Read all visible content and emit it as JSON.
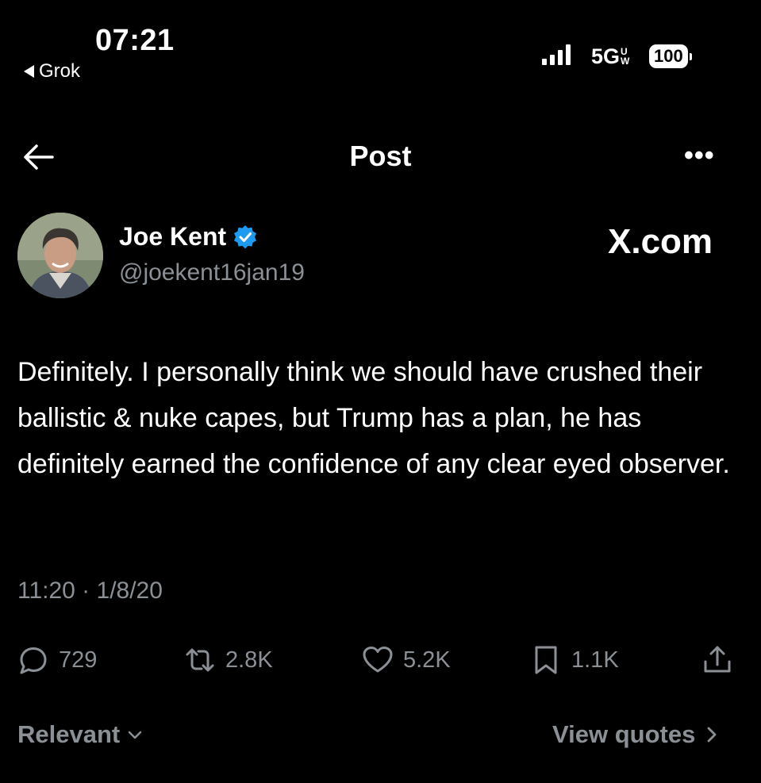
{
  "status_bar": {
    "time": "07:21",
    "back_app": "Grok",
    "network": "5G",
    "network_sup": "U",
    "network_sub": "W",
    "battery": "100"
  },
  "header": {
    "title": "Post",
    "more_glyph": "•••"
  },
  "author": {
    "name": "Joe Kent",
    "handle": "@joekent16jan19",
    "verified_color": "#1d9bf0"
  },
  "watermark": "X.com",
  "tweet": {
    "text": "Definitely. I personally think we should have crushed their ballistic & nuke capes, but Trump has a plan, he has definitely earned the confidence of any clear eyed observer.",
    "timestamp": "11:20 · 1/8/20"
  },
  "actions": {
    "replies": "729",
    "reposts": "2.8K",
    "likes": "5.2K",
    "bookmarks": "1.1K"
  },
  "footer": {
    "sort_label": "Relevant",
    "view_quotes": "View quotes"
  },
  "colors": {
    "background": "#000000",
    "text": "#ffffff",
    "muted": "#8b9096",
    "accent": "#1d9bf0"
  },
  "icons": [
    "back-arrow-icon",
    "more-icon",
    "verified-icon",
    "reply-icon",
    "repost-icon",
    "like-icon",
    "bookmark-icon",
    "share-icon",
    "chevron-down-icon",
    "chevron-right-icon"
  ]
}
